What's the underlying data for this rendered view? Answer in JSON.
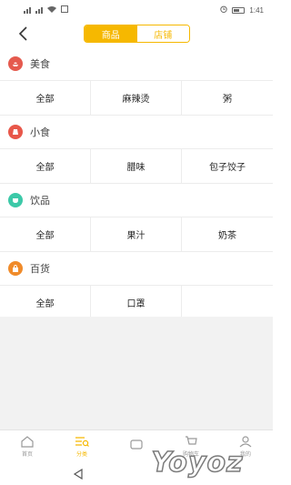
{
  "status": {
    "left_text": "",
    "time": "1:41"
  },
  "header": {
    "tabs": [
      {
        "label": "商品",
        "active": true
      },
      {
        "label": "店铺",
        "active": false
      }
    ]
  },
  "categories": [
    {
      "name": "美食",
      "icon": "food-icon",
      "color": "#e55a4e",
      "items": [
        "全部",
        "麻辣烫",
        "粥"
      ]
    },
    {
      "name": "小食",
      "icon": "snack-icon",
      "color": "#e8574a",
      "items": [
        "全部",
        "腊味",
        "包子饺子"
      ]
    },
    {
      "name": "饮品",
      "icon": "drink-icon",
      "color": "#3cc9a8",
      "items": [
        "全部",
        "果汁",
        "奶茶"
      ]
    },
    {
      "name": "百货",
      "icon": "bag-icon",
      "color": "#f08b2a",
      "items": [
        "全部",
        "口罩",
        ""
      ]
    }
  ],
  "tabbar": {
    "items": [
      {
        "label": "首页",
        "icon": "home-icon",
        "active": false
      },
      {
        "label": "分类",
        "icon": "category-icon",
        "active": true
      },
      {
        "label": "",
        "icon": "message-icon",
        "active": false
      },
      {
        "label": "购物车",
        "icon": "cart-icon",
        "active": false
      },
      {
        "label": "我的",
        "icon": "profile-icon",
        "active": false
      }
    ]
  },
  "watermark": "Yoyoz",
  "colors": {
    "accent": "#f6b800",
    "background_gray": "#f2f2f2"
  }
}
